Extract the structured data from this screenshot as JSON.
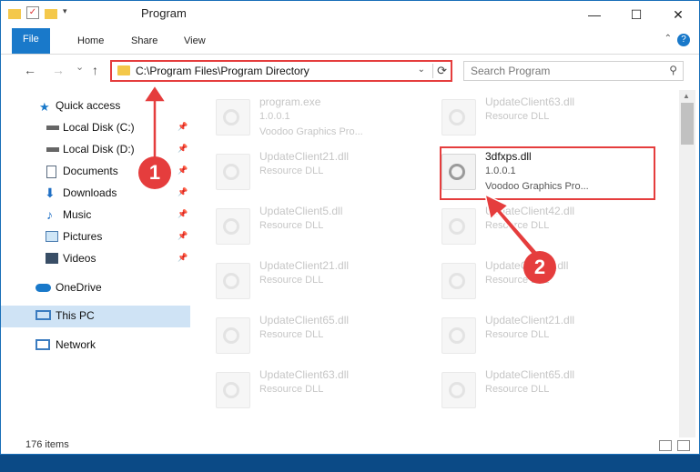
{
  "window": {
    "title": "Program",
    "minimize": "—",
    "maximize": "☐",
    "close": "✕"
  },
  "ribbon": {
    "tabs": [
      "File",
      "Home",
      "Share",
      "View"
    ],
    "help": "?"
  },
  "nav": {
    "back": "←",
    "forward": "→",
    "recent": "⌄",
    "up": "↑",
    "address": "C:\\Program Files\\Program Directory",
    "address_dropdown": "⌄",
    "refresh": "⟳",
    "search_placeholder": "Search Program"
  },
  "sidebar": {
    "items": [
      {
        "label": "Quick access",
        "icon": "star-icon"
      },
      {
        "label": "Local Disk (C:)",
        "icon": "drive-icon",
        "pinned": true
      },
      {
        "label": "Local Disk (D:)",
        "icon": "drive-icon",
        "pinned": true
      },
      {
        "label": "Documents",
        "icon": "documents-icon",
        "pinned": true
      },
      {
        "label": "Downloads",
        "icon": "download-icon",
        "pinned": true
      },
      {
        "label": "Music",
        "icon": "music-icon",
        "pinned": true
      },
      {
        "label": "Pictures",
        "icon": "pictures-icon",
        "pinned": true
      },
      {
        "label": "Videos",
        "icon": "videos-icon",
        "pinned": true
      },
      {
        "label": "OneDrive",
        "icon": "cloud-icon"
      },
      {
        "label": "This PC",
        "icon": "computer-icon",
        "selected": true
      },
      {
        "label": "Network",
        "icon": "network-icon"
      }
    ]
  },
  "files": [
    {
      "name": "program.exe",
      "type": "1.0.0.1",
      "publisher": "Voodoo Graphics Pro..."
    },
    {
      "name": "UpdateClient63.dll",
      "type": "Resource DLL",
      "publisher": ""
    },
    {
      "name": "UpdateClient21.dll",
      "type": "Resource DLL",
      "publisher": ""
    },
    {
      "name": "3dfxps.dll",
      "type": "1.0.0.1",
      "publisher": "Voodoo Graphics Pro...",
      "highlighted": true
    },
    {
      "name": "UpdateClient5.dll",
      "type": "Resource DLL",
      "publisher": ""
    },
    {
      "name": "UpdateClient42.dll",
      "type": "Resource DLL",
      "publisher": ""
    },
    {
      "name": "UpdateClient21.dll",
      "type": "Resource DLL",
      "publisher": ""
    },
    {
      "name": "UpdateClient9.dll",
      "type": "Resource DLL",
      "publisher": ""
    },
    {
      "name": "UpdateClient65.dll",
      "type": "Resource DLL",
      "publisher": ""
    },
    {
      "name": "UpdateClient21.dll",
      "type": "Resource DLL",
      "publisher": ""
    },
    {
      "name": "UpdateClient63.dll",
      "type": "Resource DLL",
      "publisher": ""
    },
    {
      "name": "UpdateClient65.dll",
      "type": "Resource DLL",
      "publisher": ""
    }
  ],
  "status": {
    "item_count": "176 items"
  },
  "callouts": [
    "1",
    "2"
  ],
  "colors": {
    "accent": "#1979ca",
    "highlight_red": "#e53d3d",
    "selected_bg": "#cfe3f5"
  }
}
